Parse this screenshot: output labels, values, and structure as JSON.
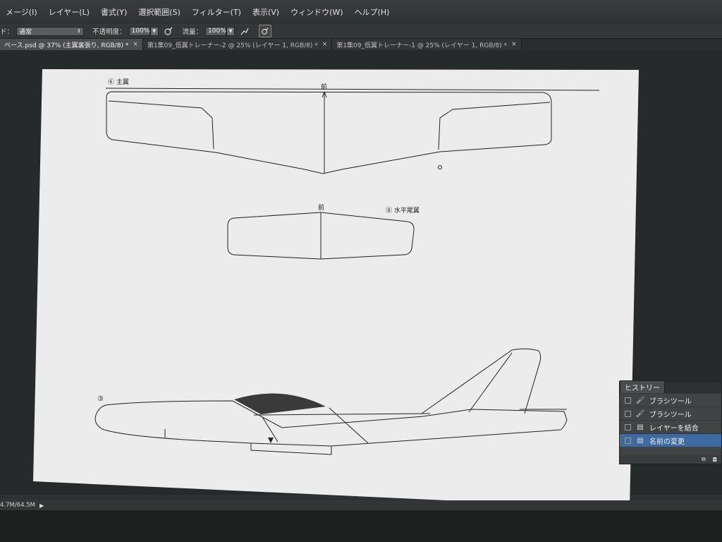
{
  "menu": {
    "items": [
      "メージ(I)",
      "レイヤー(L)",
      "書式(Y)",
      "選択範囲(S)",
      "フィルター(T)",
      "表示(V)",
      "ウィンドウ(W)",
      "ヘルプ(H)"
    ]
  },
  "options": {
    "mode_label": "ド：",
    "mode_value": "通常",
    "opacity_label": "不透明度：",
    "opacity_value": "100%",
    "flow_label": "流量：",
    "flow_value": "100%"
  },
  "tabs": [
    {
      "label": "ベース.psd @ 37% (主翼裏張り, RGB/8) *",
      "active": true
    },
    {
      "label": "第1集09_低翼トレーナー-2 @ 25% (レイヤー 1, RGB/8) *",
      "active": false
    },
    {
      "label": "第1集09_低翼トレーナー-1 @ 25% (レイヤー 1, RGB/8) *",
      "active": false
    }
  ],
  "drawing": {
    "main_wing_label": "⑥ 主翼",
    "front_label_1": "前",
    "front_label_2": "前",
    "tail_label": "⑧ 水平尾翼",
    "fuselage_label": "③"
  },
  "status": {
    "doc_size": "4.7M/64.5M"
  },
  "history": {
    "title": "ヒストリー",
    "items": [
      {
        "label": "ブラシツール",
        "icon": "brush-icon",
        "selected": false
      },
      {
        "label": "ブラシツール",
        "icon": "brush-icon",
        "selected": false
      },
      {
        "label": "レイヤーを結合",
        "icon": "document-icon",
        "selected": false
      },
      {
        "label": "名前の変更",
        "icon": "document-icon",
        "selected": true
      }
    ]
  },
  "colors": {
    "selection": "#3d6aa0",
    "paper": "#ececec",
    "canopy": "#3a3a3a"
  }
}
